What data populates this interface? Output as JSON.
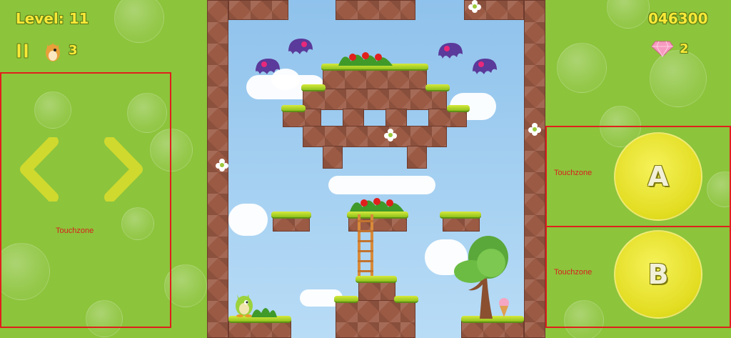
{
  "hud": {
    "level_text": "Level: 11",
    "lives": "3",
    "score": "046300",
    "gems": "2"
  },
  "controls": {
    "left_touchzone_label": "Touchzone",
    "a_touchzone_label": "Touchzone",
    "b_touchzone_label": "Touchzone",
    "a_button_label": "A",
    "b_button_label": "B"
  },
  "icons": {
    "pause": "pause-icon",
    "lives": "player-icon",
    "gems": "gem-icon",
    "left": "arrow-left-icon",
    "right": "arrow-right-icon"
  },
  "colors": {
    "panel": "#8cc43c",
    "hud_text": "#f8e838",
    "touchzone_border": "#e0201c",
    "button": "#e2dc20"
  }
}
